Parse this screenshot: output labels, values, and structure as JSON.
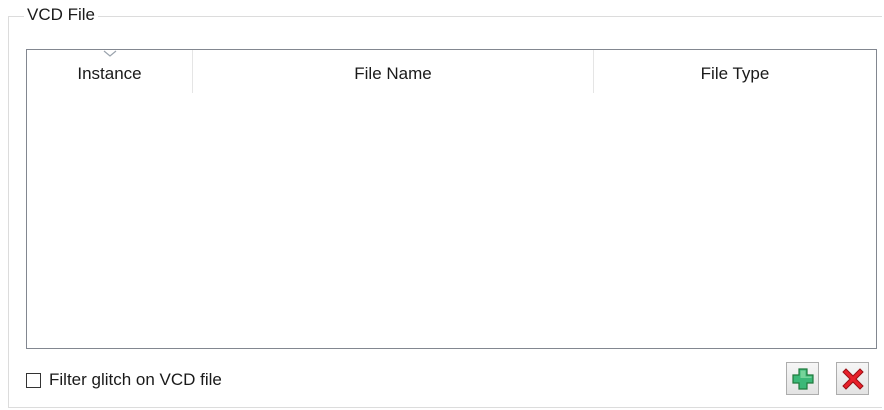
{
  "group": {
    "title": "VCD File"
  },
  "table": {
    "columns": [
      {
        "label": "Instance"
      },
      {
        "label": "File Name"
      },
      {
        "label": "File Type"
      }
    ],
    "sorted_column": "Instance",
    "rows": []
  },
  "options": {
    "filter_glitch_label": "Filter glitch on VCD file",
    "filter_glitch_checked": false
  },
  "toolbar": {
    "add_icon": "plus-icon",
    "add_color": "#3cb878",
    "remove_icon": "close-icon",
    "remove_color": "#e8202a"
  }
}
